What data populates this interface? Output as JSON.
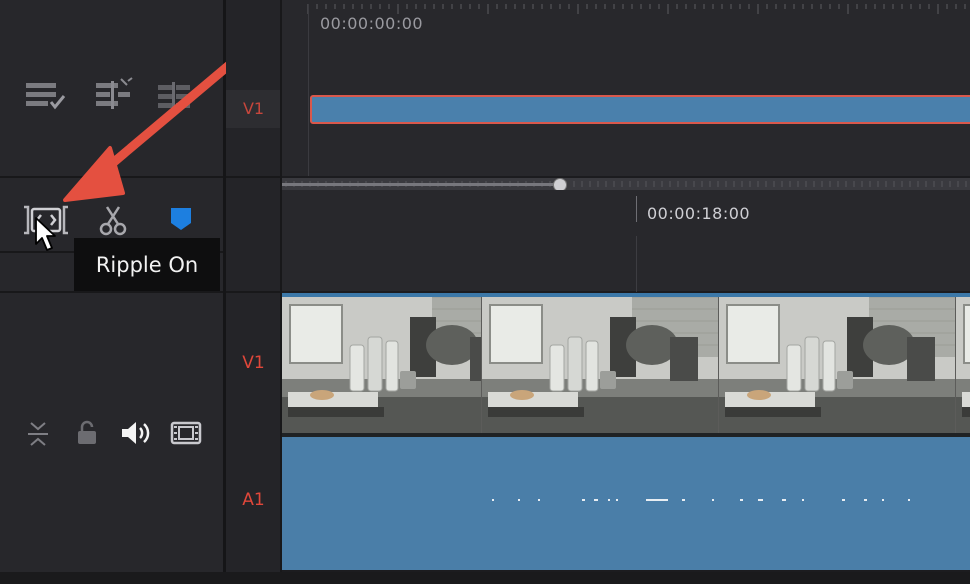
{
  "timeline": {
    "upper_timecode": "00:00:00:00",
    "lower_timecode": "00:00:18:00"
  },
  "tracks": {
    "upper_video_label": "V1",
    "video_label": "V1",
    "audio_label": "A1"
  },
  "tooltip": {
    "text": "Ripple On"
  },
  "toolbar": {
    "top_icons": [
      "timeline-options-icon",
      "snapping-settings-icon",
      "linked-tool-icon"
    ],
    "edit_icons": [
      "ripple-trim-icon",
      "blade-cut-icon",
      "marker-flag-icon"
    ],
    "track_controls": [
      "collapse-track-icon",
      "lock-track-icon",
      "audio-speaker-icon",
      "film-clip-icon"
    ]
  },
  "colors": {
    "track_label": "#e0473a",
    "clip_blue": "#4a80ac",
    "clip_outline": "#d9584c",
    "annotation_arrow": "#e45040",
    "marker_blue": "#1d7fe0"
  }
}
